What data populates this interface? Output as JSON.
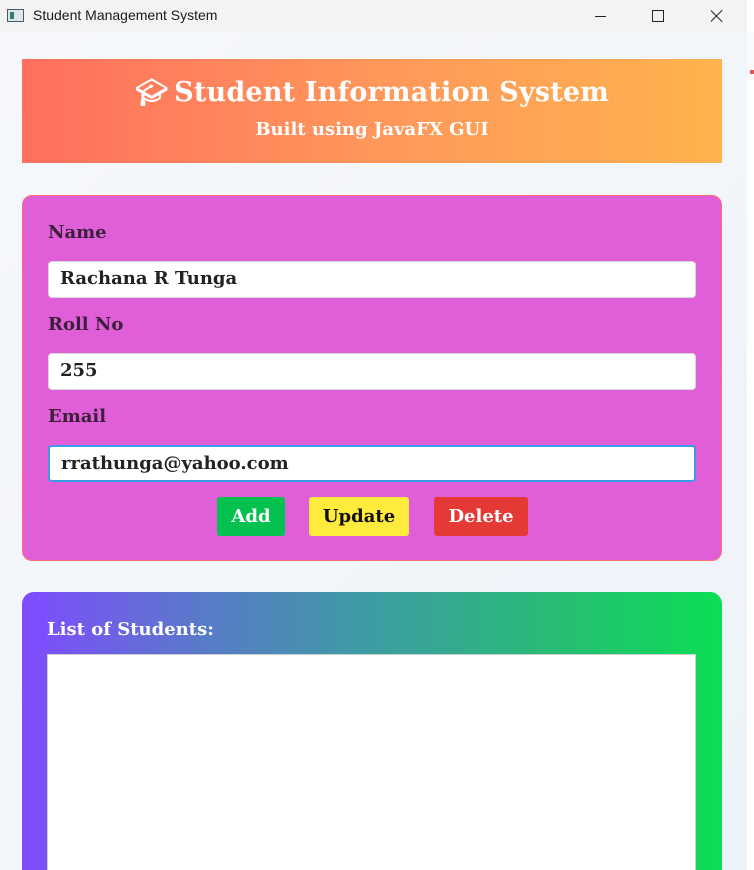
{
  "window": {
    "title": "Student Management System",
    "controls": [
      "minimize",
      "maximize",
      "close"
    ]
  },
  "header": {
    "icon": "graduation-cap-icon",
    "title": "Student Information System",
    "subtitle": "Built using JavaFX GUI",
    "gradient": [
      "#ff6f5e",
      "#ffb34d"
    ]
  },
  "form": {
    "name_label": "Name",
    "name_value": "Rachana R Tunga",
    "roll_label": "Roll No",
    "roll_value": "255",
    "email_label": "Email",
    "email_value": "rrathunga@yahoo.com",
    "panel_color": "#e05fd8",
    "buttons": {
      "add": "Add",
      "update": "Update",
      "delete": "Delete"
    },
    "button_colors": {
      "add": "#05c150",
      "update": "#ffeb3b",
      "delete": "#e53935"
    }
  },
  "list": {
    "title": "List of Students:",
    "items": [],
    "gradient": [
      "#7f4bff",
      "#0bde55"
    ]
  }
}
